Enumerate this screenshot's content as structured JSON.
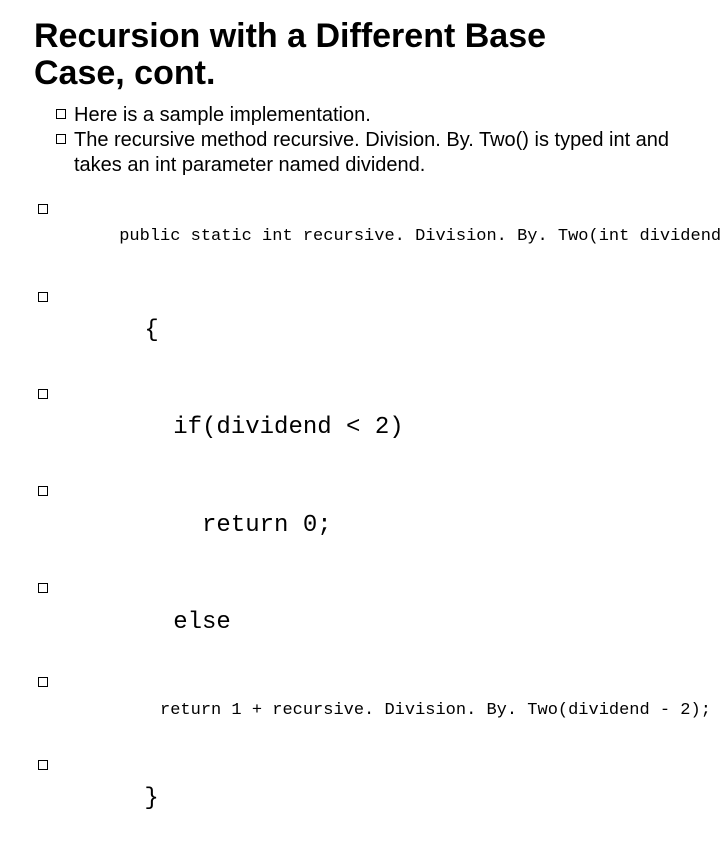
{
  "title": {
    "line1": "Recursion with a Different Base",
    "line2": "Case, cont."
  },
  "bullets": {
    "b1_lead": "Here",
    "b1_rest": " is a sample implementation.",
    "b2_lead": "The",
    "b2_rest": " recursive method recursive. Division. By. Two() is typed int and takes an int parameter named dividend."
  },
  "code": {
    "l1": "public static int recursive. Division. By. Two(int dividend)",
    "l2": "{",
    "l3": "  if(dividend < 2)",
    "l4": "    return 0;",
    "l5": "  else",
    "l6": "    return 1 + recursive. Division. By. Two(dividend - 2);",
    "l7": "}"
  }
}
